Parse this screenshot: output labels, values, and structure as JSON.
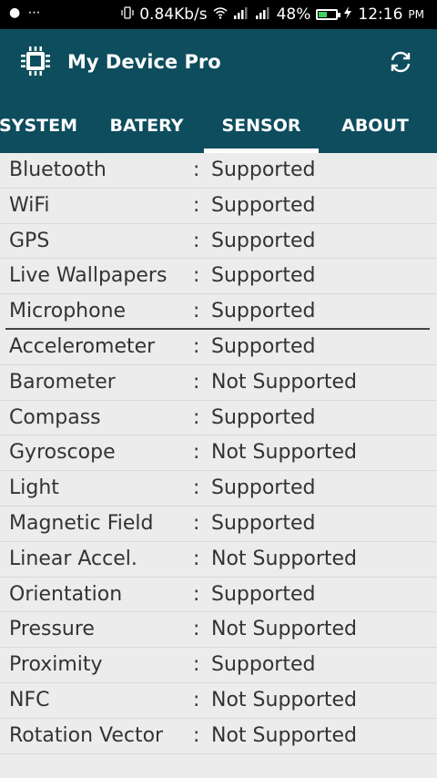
{
  "status_bar": {
    "left_icons": "● ⋯",
    "net_speed": "0.84Kb/s",
    "battery_pct": "48%",
    "battery_level": 0.48,
    "time": "12:16",
    "ampm": "PM"
  },
  "app": {
    "title": "My Device Pro"
  },
  "tabs": [
    {
      "label": "SYSTEM"
    },
    {
      "label": "BATERY"
    },
    {
      "label": "SENSOR",
      "active": true
    },
    {
      "label": "ABOUT"
    }
  ],
  "rows": [
    {
      "label": "Bluetooth",
      "value": "Supported"
    },
    {
      "label": "WiFi",
      "value": "Supported"
    },
    {
      "label": "GPS",
      "value": "Supported"
    },
    {
      "label": "Live Wallpapers",
      "value": "Supported"
    },
    {
      "label": "Microphone",
      "value": "Supported"
    },
    {
      "label": "Accelerometer",
      "value": "Supported"
    },
    {
      "label": "Barometer",
      "value": "Not Supported"
    },
    {
      "label": "Compass",
      "value": "Supported"
    },
    {
      "label": "Gyroscope",
      "value": "Not Supported"
    },
    {
      "label": "Light",
      "value": "Supported"
    },
    {
      "label": "Magnetic Field",
      "value": "Supported"
    },
    {
      "label": "Linear Accel.",
      "value": "Not Supported"
    },
    {
      "label": "Orientation",
      "value": "Supported"
    },
    {
      "label": "Pressure",
      "value": "Not Supported"
    },
    {
      "label": "Proximity",
      "value": "Supported"
    },
    {
      "label": "NFC",
      "value": "Not Supported"
    },
    {
      "label": "Rotation Vector",
      "value": "Not Supported"
    }
  ],
  "separator": ":",
  "colors": {
    "app_bar": "#0d4d5d",
    "list_bg": "#ececec",
    "text": "#333333"
  },
  "icons": [
    "cpu-chip-icon",
    "refresh-icon",
    "vibrate-icon",
    "wifi-icon",
    "signal-icon",
    "battery-icon",
    "charging-icon"
  ]
}
